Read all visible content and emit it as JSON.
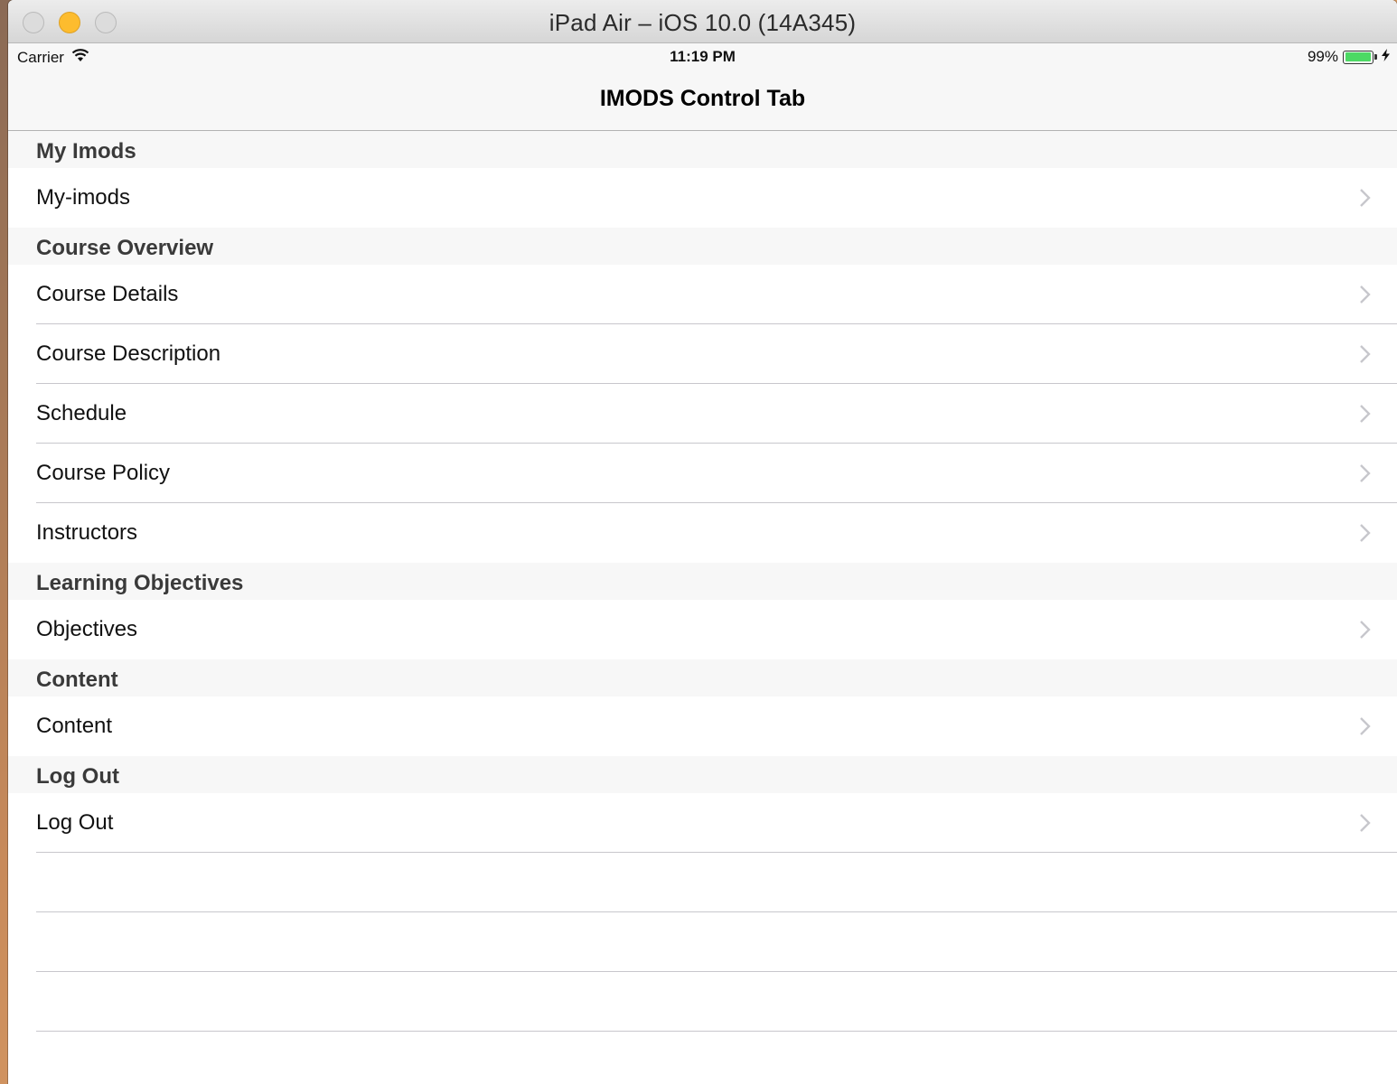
{
  "window": {
    "title": "iPad Air – iOS 10.0 (14A345)"
  },
  "statusbar": {
    "carrier": "Carrier",
    "time": "11:19 PM",
    "battery": "99%",
    "battery_level": 0.99,
    "battery_color": "#4cd964"
  },
  "navbar": {
    "title": "IMODS Control Tab"
  },
  "sections": {
    "my_imods": {
      "header": "My Imods",
      "items": [
        "My-imods"
      ]
    },
    "course_overview": {
      "header": "Course Overview",
      "items": [
        "Course Details",
        "Course Description",
        "Schedule",
        "Course Policy",
        "Instructors"
      ]
    },
    "learning_objectives": {
      "header": "Learning Objectives",
      "items": [
        "Objectives"
      ]
    },
    "content": {
      "header": "Content",
      "items": [
        "Content"
      ]
    },
    "log_out": {
      "header": "Log Out",
      "items": [
        "Log Out"
      ]
    }
  },
  "icons": {
    "disclosure": "chevron-right-icon",
    "wifi": "wifi-icon",
    "battery": "battery-icon",
    "charging": "bolt-icon"
  }
}
